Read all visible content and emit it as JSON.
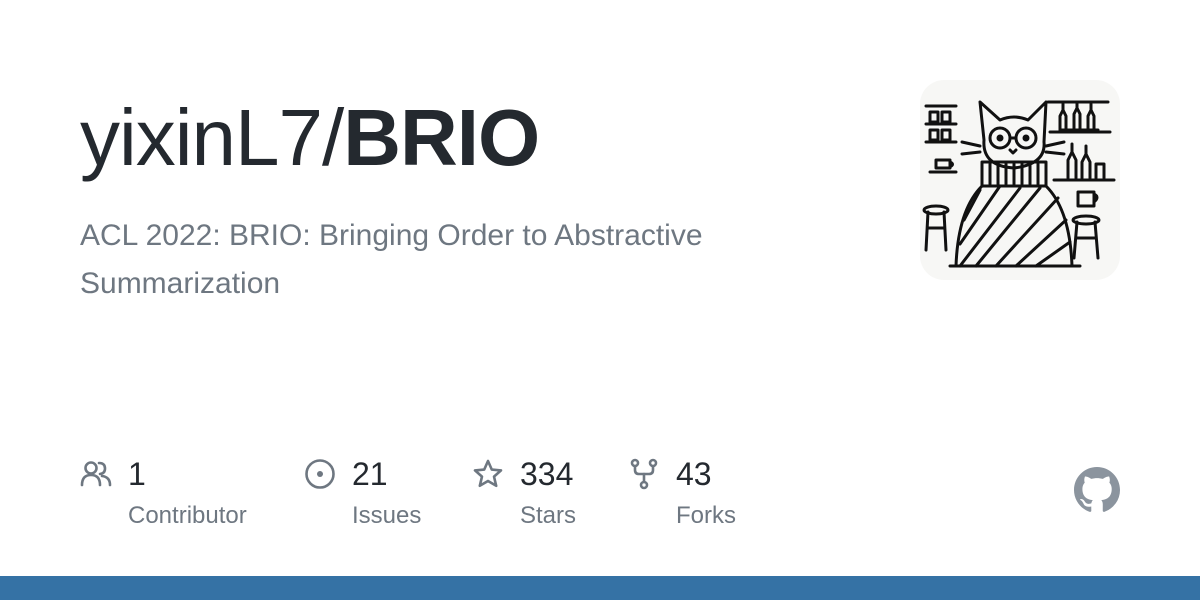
{
  "repo": {
    "owner": "yixinL7/",
    "name": "BRIO",
    "description": "ACL 2022: BRIO: Bringing Order to Abstractive Summarization"
  },
  "stats": {
    "contributors": {
      "count": "1",
      "label": "Contributor",
      "icon": "people-icon"
    },
    "issues": {
      "count": "21",
      "label": "Issues",
      "icon": "issue-opened-icon"
    },
    "stars": {
      "count": "334",
      "label": "Stars",
      "icon": "star-icon"
    },
    "forks": {
      "count": "43",
      "label": "Forks",
      "icon": "repo-forked-icon"
    }
  },
  "avatar": {
    "icon": "cat-cafe-avatar"
  },
  "brand": {
    "icon": "github-mark-icon",
    "color": "#8b949e"
  },
  "language_bar": {
    "color": "#3572a5"
  },
  "colors": {
    "text": "#24292f",
    "muted": "#6e7781"
  }
}
